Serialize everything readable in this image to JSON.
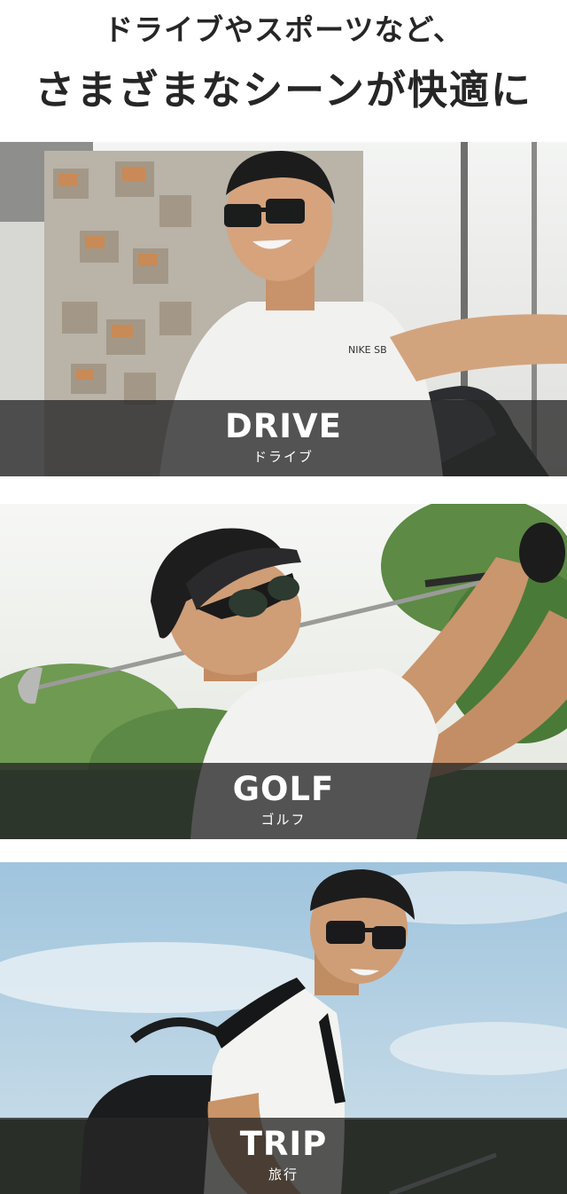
{
  "header": {
    "line1": "ドライブやスポーツなど、",
    "line2": "さまざまなシーンが快適に"
  },
  "scenes": [
    {
      "id": "drive",
      "title_en": "DRIVE",
      "title_ja": "ドライブ",
      "shirt_logo": "NIKE SB"
    },
    {
      "id": "golf",
      "title_en": "GOLF",
      "title_ja": "ゴルフ"
    },
    {
      "id": "trip",
      "title_en": "TRIP",
      "title_ja": "旅行"
    }
  ],
  "colors": {
    "heading_text": "#262626",
    "caption_band": "#262626",
    "caption_text": "#ffffff",
    "page_background": "#ffffff"
  }
}
